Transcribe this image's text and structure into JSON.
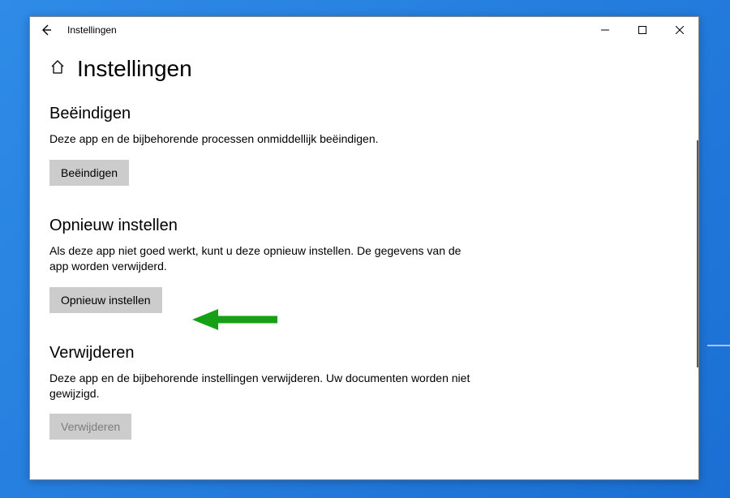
{
  "titlebar": {
    "title": "Instellingen"
  },
  "page": {
    "title": "Instellingen"
  },
  "sections": {
    "terminate": {
      "title": "Beëindigen",
      "description": "Deze app en de bijbehorende processen onmiddellijk beëindigen.",
      "button": "Beëindigen"
    },
    "reset": {
      "title": "Opnieuw instellen",
      "description": "Als deze app niet goed werkt, kunt u deze opnieuw instellen. De gegevens van de app worden verwijderd.",
      "button": "Opnieuw instellen"
    },
    "uninstall": {
      "title": "Verwijderen",
      "description": "Deze app en de bijbehorende instellingen verwijderen. Uw documenten worden niet gewijzigd.",
      "button": "Verwijderen"
    }
  }
}
